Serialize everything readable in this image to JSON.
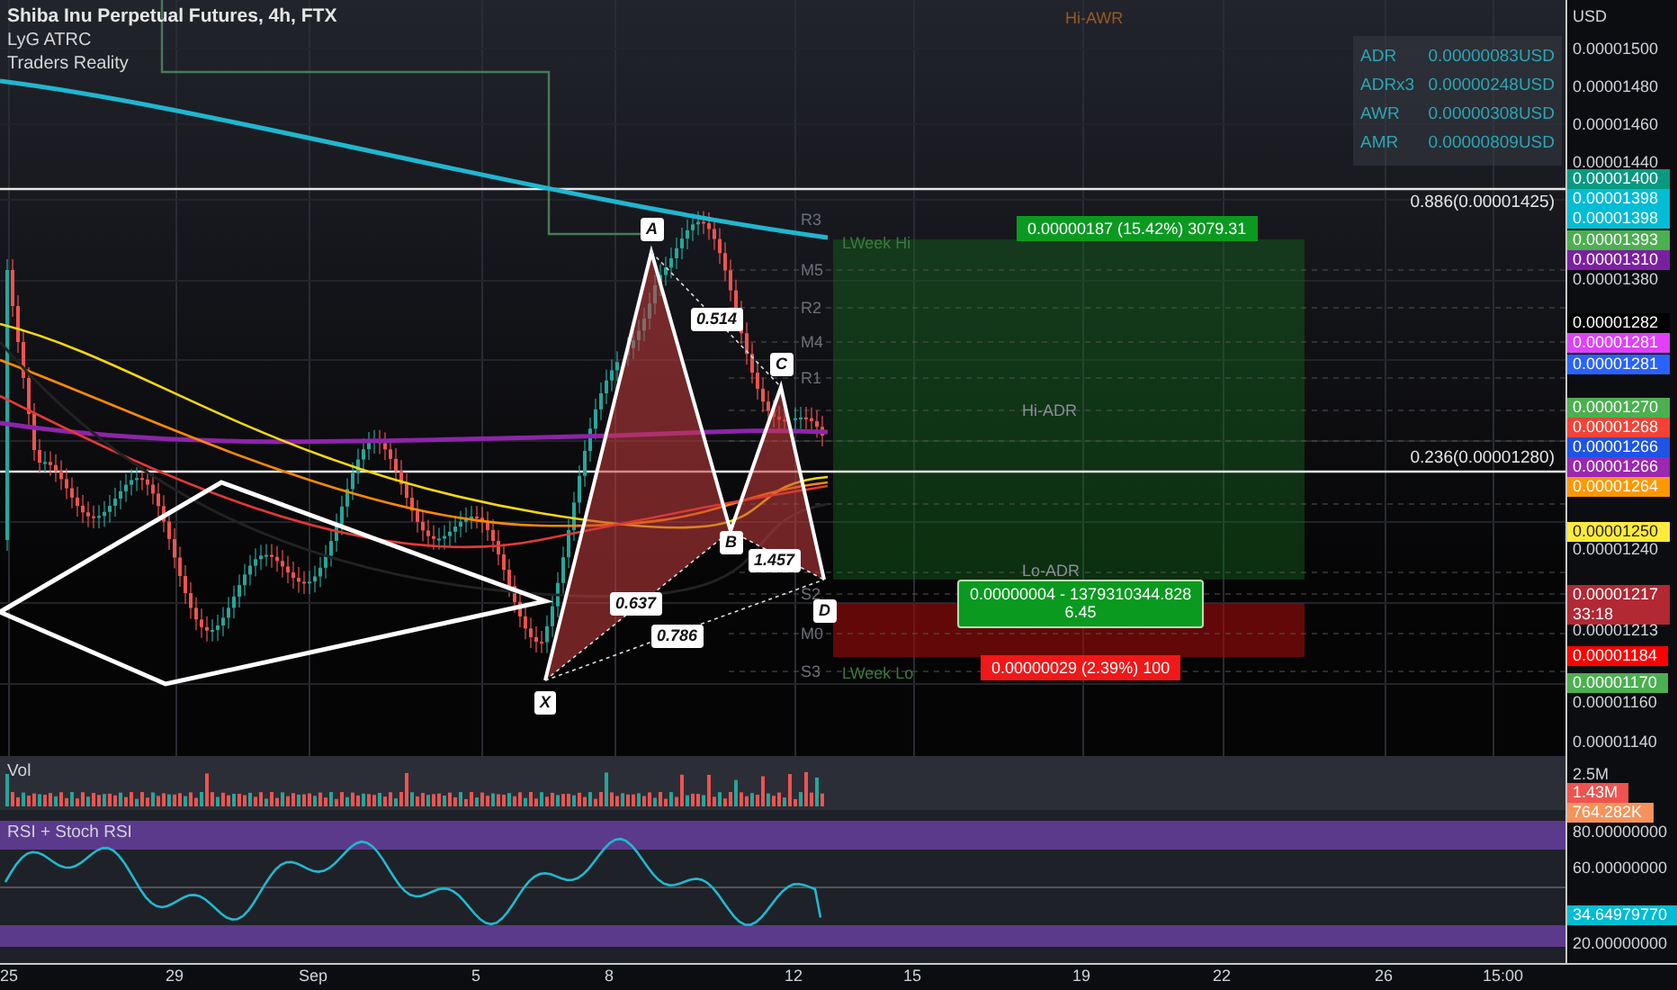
{
  "legend": {
    "title": "Shiba Inu Perpetual Futures, 4h, FTX",
    "indicators": [
      "LyG ATRC",
      "Traders Reality"
    ]
  },
  "range_table": [
    {
      "label": "ADR",
      "value": "0.00000083USD"
    },
    {
      "label": "ADRx3",
      "value": "0.00000248USD"
    },
    {
      "label": "AWR",
      "value": "0.00000308USD"
    },
    {
      "label": "AMR",
      "value": "0.00000809USD"
    }
  ],
  "level_labels": [
    {
      "text": "Hi-AWR",
      "kind": "awr"
    },
    {
      "text": "LWeek Hi",
      "kind": "week"
    },
    {
      "text": "Hi-ADR",
      "kind": "adr"
    },
    {
      "text": "Lo-ADR",
      "kind": "adr"
    },
    {
      "text": "LWeek Lo",
      "kind": "week"
    }
  ],
  "pivot_labels": [
    "R3",
    "M5",
    "R2",
    "M4",
    "R1",
    "S2",
    "M0",
    "S3"
  ],
  "fib_levels": [
    "0.886(0.00001425)",
    "0.236(0.00001280)"
  ],
  "pattern": {
    "points": [
      "A",
      "C",
      "B",
      "D",
      "X"
    ],
    "ratios": [
      "0.514",
      "1.457",
      "0.637",
      "0.786"
    ]
  },
  "position": {
    "target": "0.00000187 (15.42%) 3079.31",
    "entry": [
      "0.00000004 - 1379310344.828",
      "6.45"
    ],
    "stop": "0.00000029 (2.39%) 100"
  },
  "volume_pane": {
    "title": "Vol"
  },
  "rsi_pane": {
    "title": "RSI + Stoch RSI"
  },
  "price_axis": {
    "unit": "USD",
    "labels": [
      {
        "text": "0.00001500"
      },
      {
        "text": "0.00001480"
      },
      {
        "text": "0.00001460"
      },
      {
        "text": "0.00001440"
      },
      {
        "text": "0.00001400",
        "color": "#089981"
      },
      {
        "text": "0.00001398",
        "color": "#00bcd4"
      },
      {
        "text": "0.00001398",
        "color": "#00bcd4"
      },
      {
        "text": "0.00001393",
        "color": "#4caf50"
      },
      {
        "text": "0.00001310",
        "color": "#7b1fa2"
      },
      {
        "text": "0.00001380"
      },
      {
        "text": "0.00001282",
        "color": "#000000"
      },
      {
        "text": "0.00001281",
        "color": "#e040fb"
      },
      {
        "text": "0.00001281",
        "color": "#2962ff"
      },
      {
        "text": "0.00001270",
        "color": "#4caf50"
      },
      {
        "text": "0.00001268",
        "color": "#f44336"
      },
      {
        "text": "0.00001266",
        "color": "#1e53e5"
      },
      {
        "text": "0.00001266",
        "color": "#9c27b0"
      },
      {
        "text": "0.00001264",
        "color": "#ff9800"
      },
      {
        "text": "0.00001250",
        "color": "#ffeb3b"
      },
      {
        "text": "0.00001240"
      },
      {
        "text": "0.00001217",
        "color": "#b22833",
        "sub": "33:18"
      },
      {
        "text": "0.00001213"
      },
      {
        "text": "0.00001184",
        "color": "#ff0000"
      },
      {
        "text": "0.00001170",
        "color": "#4caf50"
      },
      {
        "text": "0.00001160"
      },
      {
        "text": "0.00001140"
      },
      {
        "text": "2.5M"
      },
      {
        "text": "1.43M",
        "color": "#ef5350"
      },
      {
        "text": "764.282K",
        "color": "#f7935a"
      },
      {
        "text": "80.00000000"
      },
      {
        "text": "60.00000000"
      },
      {
        "text": "34.64979770",
        "color": "#00bcd4"
      },
      {
        "text": "20.00000000"
      }
    ]
  },
  "time_axis": [
    "25",
    "29",
    "Sep",
    "5",
    "8",
    "12",
    "15",
    "19",
    "22",
    "26",
    "15:00"
  ]
}
